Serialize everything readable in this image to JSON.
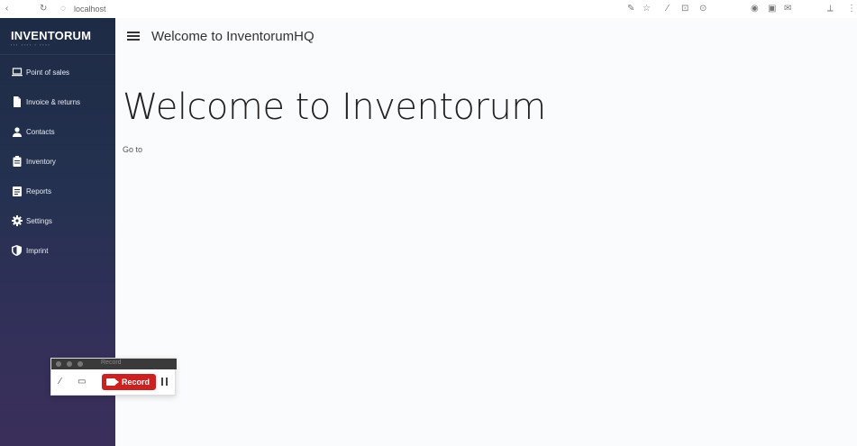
{
  "browser": {
    "url": "localhost",
    "back_icon": "back-arrow-icon",
    "reload_icon": "reload-icon"
  },
  "sidebar": {
    "brand": "INVENTORUM",
    "items": [
      {
        "label": "Point of sales",
        "icon": "laptop-icon"
      },
      {
        "label": "Invoice & returns",
        "icon": "document-icon"
      },
      {
        "label": "Contacts",
        "icon": "person-icon"
      },
      {
        "label": "Inventory",
        "icon": "clipboard-icon"
      },
      {
        "label": "Reports",
        "icon": "list-icon"
      },
      {
        "label": "Settings",
        "icon": "gear-icon"
      },
      {
        "label": "Imprint",
        "icon": "shield-icon"
      }
    ]
  },
  "header": {
    "title": "Welcome to InventorumHQ"
  },
  "main": {
    "heading": "Welcome to Inventorum",
    "link": "Go to"
  },
  "recorder": {
    "title": "Record",
    "record_label": "Record"
  },
  "colors": {
    "sidebar_top": "#1e2b45",
    "sidebar_bottom": "#3a2f5a",
    "record_red": "#d01f1f"
  }
}
